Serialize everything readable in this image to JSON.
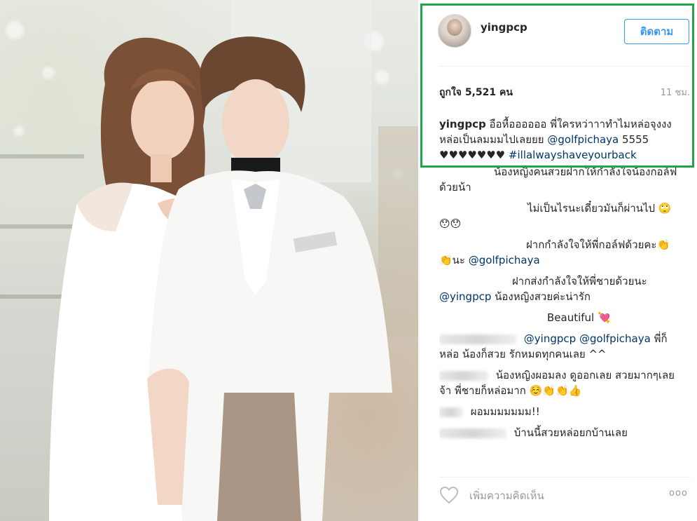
{
  "post": {
    "username": "yingpcp",
    "follow_label": "ติดตาม",
    "likes": "ถูกใจ 5,521 คน",
    "time": "11 ชม.",
    "caption": {
      "user": "yingpcp",
      "text": "อือหื้ออออออ พี่ใครหว่าาาทำไมหล่อจุงงง หล่อเป็นลมมมไปเลยยย",
      "mention": "@golfpichaya",
      "text2": "5555 ♥♥♥♥♥♥♥",
      "hashtag": "#illalwayshaveyourback"
    }
  },
  "comments": [
    {
      "text": "น้องหญิงคนสวยฝากให้กำลังใจน้องกอล์ฟด้วยน้า"
    },
    {
      "text": "ไม่เป็นไรนะเดี๋ยวมันก็ผ่านไป 🙄😯😯"
    },
    {
      "text": "ฝากกำลังใจให้พี่กอล์ฟด้วยคะ👏👏นะ",
      "mention": "@golfpichaya"
    },
    {
      "text": "ฝากส่งกำลังใจให้พี่ชายด้วยนะ",
      "mention": "@yingpcp",
      "text2": "น้องหญิงสวยค่ะน่ารัก"
    },
    {
      "text": "Beautiful 💘"
    },
    {
      "mention": "@yingpcp",
      "mention2": "@golfpichaya",
      "text": "พี่ก็หล่อ น้องก็สวย รักหมดทุกคนเลย ^^"
    },
    {
      "text": "น้องหญิงผอมลง ดูออกเลย สวยมากๆเลยจ้า พี่ชายก็หล่อมาก ☺️👏👏👍"
    },
    {
      "text": "ผอมมมมมมม!!"
    },
    {
      "text": "บ้านนี้สวยหล่อยกบ้านเลย"
    }
  ],
  "footer": {
    "add_comment_placeholder": "เพิ่มความคิดเห็น",
    "more_label": "ooo"
  },
  "icons": {
    "heart": "heart-icon",
    "more": "more-options-icon"
  },
  "colors": {
    "highlight_border": "#1ea64a",
    "link": "#003569",
    "follow": "#3897f0"
  }
}
